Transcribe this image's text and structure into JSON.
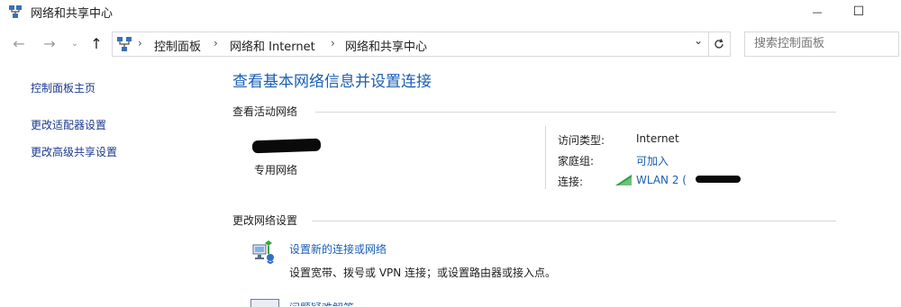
{
  "window": {
    "title": "网络和共享中心",
    "controls": {
      "minimize": "—",
      "maximize": "☐"
    }
  },
  "address": {
    "breadcrumbs": [
      "控制面板",
      "网络和 Internet",
      "网络和共享中心"
    ],
    "search_placeholder": "搜索控制面板"
  },
  "sidebar": {
    "items": [
      {
        "label": "控制面板主页"
      },
      {
        "label": "更改适配器设置"
      },
      {
        "label": "更改高级共享设置"
      }
    ]
  },
  "main": {
    "title": "查看基本网络信息并设置连接",
    "active_networks_header": "查看活动网络",
    "network_type": "专用网络",
    "access_type_label": "访问类型:",
    "access_type_value": "Internet",
    "homegroup_label": "家庭组:",
    "homegroup_value": "可加入",
    "connections_label": "连接:",
    "connection_value": "WLAN 2 (",
    "change_settings_header": "更改网络设置",
    "tasks": [
      {
        "label": "设置新的连接或网络",
        "description": "设置宽带、拨号或 VPN 连接；或设置路由器或接入点。",
        "icon": "network-setup-icon"
      },
      {
        "label": "问题疑难解答",
        "icon": "troubleshoot-icon"
      }
    ]
  },
  "colors": {
    "link": "#1a5fb4",
    "sidebar_link": "#1b3a8f",
    "wifi_signal": "#2e9b3e"
  }
}
